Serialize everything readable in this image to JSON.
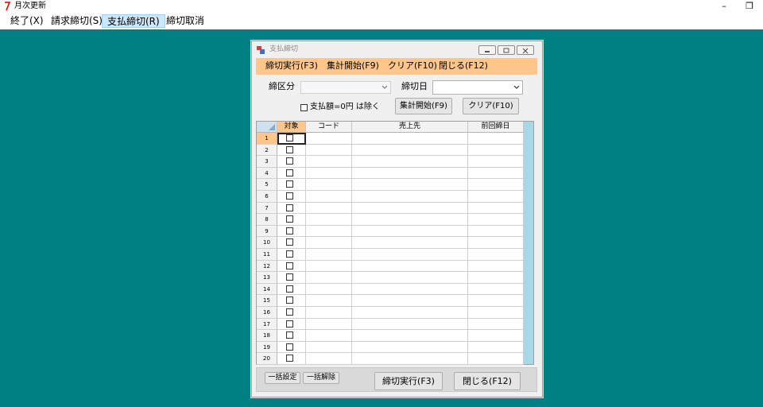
{
  "app": {
    "title": "月次更新",
    "minimize": "–",
    "restore": "❐",
    "menu": [
      {
        "label": "終了(X)"
      },
      {
        "label": "請求締切(S)"
      },
      {
        "label": "支払締切(R)"
      },
      {
        "label": "締切取消"
      }
    ]
  },
  "window": {
    "title": "支払締切",
    "menu": [
      {
        "label": "締切実行(F3)"
      },
      {
        "label": "集計開始(F9)"
      },
      {
        "label": "クリア(F10)"
      },
      {
        "label": "閉じる(F12)"
      }
    ],
    "form": {
      "closing_category_label": "締区分",
      "closing_category_value": "",
      "closing_date_label": "締切日",
      "closing_date_value": "",
      "exclude_zero_label": "支払額=0円 は除く",
      "aggregate_button": "集計開始(F9)",
      "clear_button": "クリア(F10)"
    },
    "grid": {
      "columns": [
        "対象",
        "コード",
        "売上先",
        "前回締日"
      ],
      "row_numbers": [
        "1",
        "2",
        "3",
        "4",
        "5",
        "6",
        "7",
        "8",
        "9",
        "10",
        "11",
        "12",
        "13",
        "14",
        "15",
        "16",
        "17",
        "18",
        "19",
        "20"
      ]
    },
    "footer": {
      "select_all": "一括設定",
      "deselect_all": "一括解除",
      "execute_button": "締切実行(F3)",
      "close_button": "閉じる(F12)"
    }
  },
  "colors": {
    "desktop": "#008080",
    "accent": "#ffc68c",
    "active_menu": "#cce8ff"
  }
}
